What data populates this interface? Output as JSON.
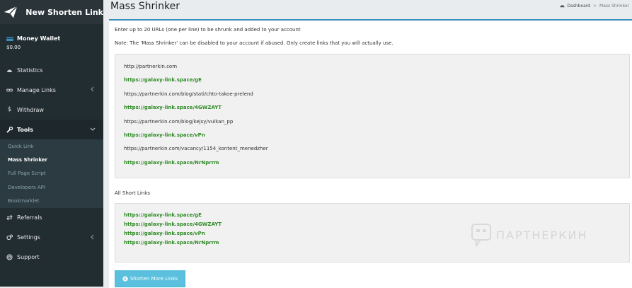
{
  "brand": {
    "title": "New Shorten Link"
  },
  "wallet": {
    "label": "Money Wallet",
    "amount": "$0.00"
  },
  "menu": {
    "statistics": "Statistics",
    "manage_links": "Manage Links",
    "withdraw": "Withdraw",
    "tools": "Tools",
    "referrals": "Referrals",
    "settings": "Settings",
    "support": "Support"
  },
  "tools_sub": {
    "quick_link": "Quick Link",
    "mass_shrinker": "Mass Shrinker",
    "full_page_script": "Full Page Script",
    "developers_api": "Developers API",
    "bookmarklet": "Bookmarklet"
  },
  "header": {
    "title": "Mass Shrinker",
    "breadcrumb": {
      "home": "Dashboard",
      "sep": ">",
      "current": "Mass Shrinker"
    }
  },
  "content": {
    "intro": "Enter up to 20 URLs (one per line) to be shrunk and added to your account",
    "note": "Note: The 'Mass Shrinker' can be disabled to your account if abused. Only create links that you will actually use.",
    "results": [
      {
        "original": "http://partnerkin.com",
        "short": "https://galaxy-link.space/gE"
      },
      {
        "original": "https://partnerkin.com/blog/stati/chto-takoe-prelend",
        "short": "https://galaxy-link.space/4GWZAYT"
      },
      {
        "original": "https://partnerkin.com/blog/kejsy/vulkan_pp",
        "short": "https://galaxy-link.space/vPn"
      },
      {
        "original": "https://partnerkin.com/vacancy/1154_kontent_menedzher",
        "short": "https://galaxy-link.space/NrNprrm"
      }
    ],
    "all_short_label": "All Short Links",
    "all_short": [
      "https://galaxy-link.space/gE",
      "https://galaxy-link.space/4GWZAYT",
      "https://galaxy-link.space/vPn",
      "https://galaxy-link.space/NrNprrm"
    ],
    "button": "Shorten More Links"
  },
  "watermark": "ПАРТНЕРКИН",
  "colors": {
    "sidebar": "#222d32",
    "accent": "#3c8dbc",
    "link_green": "#2e8b26",
    "button": "#5bc0de"
  }
}
